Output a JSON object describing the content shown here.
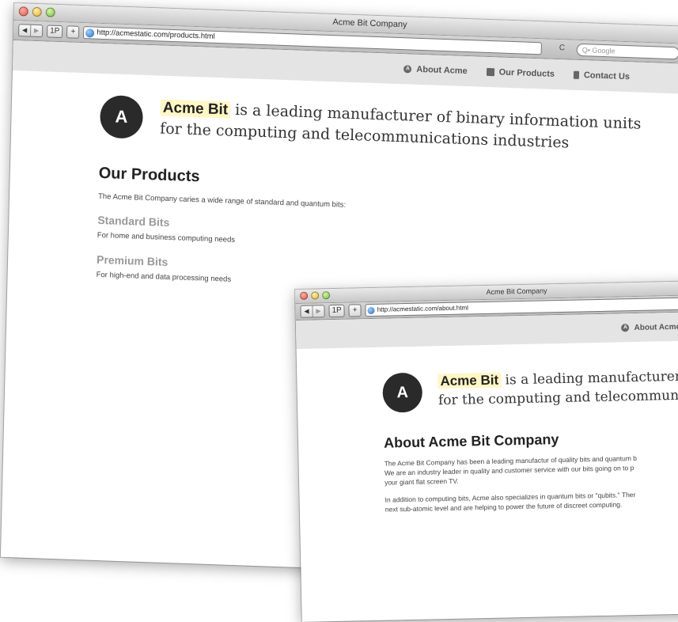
{
  "back_window": {
    "title": "Acme Bit Company",
    "url": "http://acmestatic.com/products.html",
    "search_placeholder": "Q• Google",
    "tab_label": "1P",
    "nav": [
      {
        "label": "About Acme",
        "icon": "circle-a-icon"
      },
      {
        "label": "Our Products",
        "icon": "book-icon"
      },
      {
        "label": "Contact Us",
        "icon": "phone-icon"
      }
    ],
    "logo_letter": "A",
    "brand": "Acme Bit",
    "tagline_line1": " is a leading manufacturer of binary information units",
    "tagline_line2": "for the computing and telecommunications industries",
    "heading": "Our Products",
    "intro": "The Acme Bit Company caries a wide range of standard and quantum bits:",
    "products": [
      {
        "name": "Standard Bits",
        "desc": "For home and business computing needs"
      },
      {
        "name": "Premium Bits",
        "desc": "For high-end and data processing needs"
      }
    ]
  },
  "front_window": {
    "title": "Acme Bit Company",
    "url": "http://acmestatic.com/about.html",
    "tab_label": "1P",
    "nav": [
      {
        "label": "About Acme",
        "icon": "circle-a-icon"
      }
    ],
    "logo_letter": "A",
    "brand": "Acme Bit",
    "tagline_line1": " is a leading manufacturer of bi",
    "tagline_line2": "for the computing and telecommunicatio",
    "heading": "About Acme Bit Company",
    "para1_line1": "The Acme Bit Company has been a leading manufactur of quality bits and quantum b",
    "para1_line2": "We are an industry leader in quality and customer service with our bits going on to p",
    "para1_line3": "your giant flat screen TV.",
    "para2_line1": "In addition to computing bits, Acme also specializes in quantum bits or \"qubits.\" Ther",
    "para2_line2": "next sub-atomic level and are helping to power the future of discreet computing."
  }
}
